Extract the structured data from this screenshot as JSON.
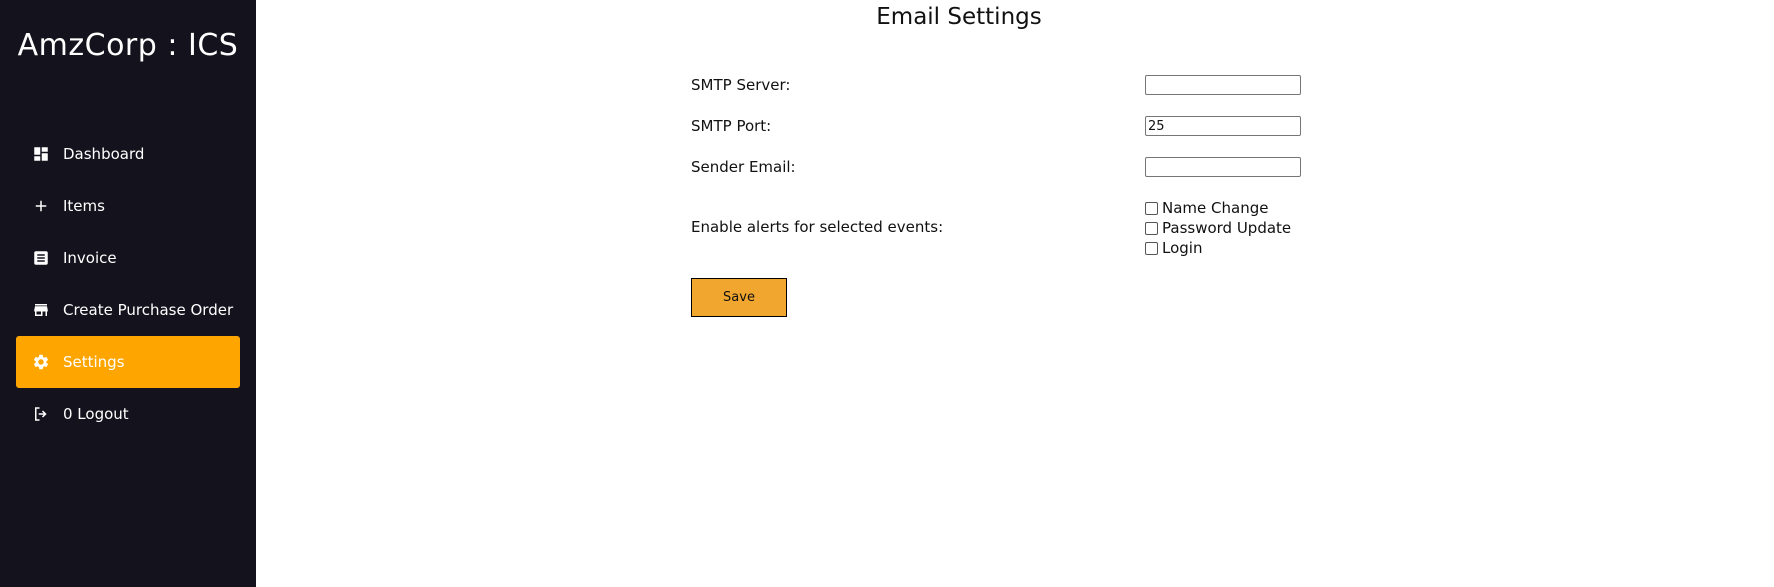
{
  "sidebar": {
    "brand": "AmzCorp : ICS",
    "items": [
      {
        "label": "Dashboard",
        "icon": "dashboard-icon"
      },
      {
        "label": "Items",
        "icon": "plus-icon"
      },
      {
        "label": "Invoice",
        "icon": "list-icon"
      },
      {
        "label": "Create Purchase Order",
        "icon": "store-icon"
      },
      {
        "label": "Settings",
        "icon": "gear-icon",
        "active": true
      },
      {
        "label": "0 Logout",
        "icon": "logout-icon"
      }
    ],
    "background": "#13121d",
    "active_color": "#ffa500"
  },
  "page": {
    "title": "Email Settings"
  },
  "form": {
    "smtp_server_label": "SMTP Server:",
    "smtp_server_value": "",
    "smtp_port_label": "SMTP Port:",
    "smtp_port_value": "25",
    "sender_email_label": "Sender Email:",
    "sender_email_value": "",
    "alerts_label": "Enable alerts for selected events:",
    "alerts": [
      {
        "label": "Name Change",
        "checked": false
      },
      {
        "label": "Password Update",
        "checked": false
      },
      {
        "label": "Login",
        "checked": false
      }
    ],
    "save_label": "Save",
    "save_color": "#f0a62f"
  }
}
